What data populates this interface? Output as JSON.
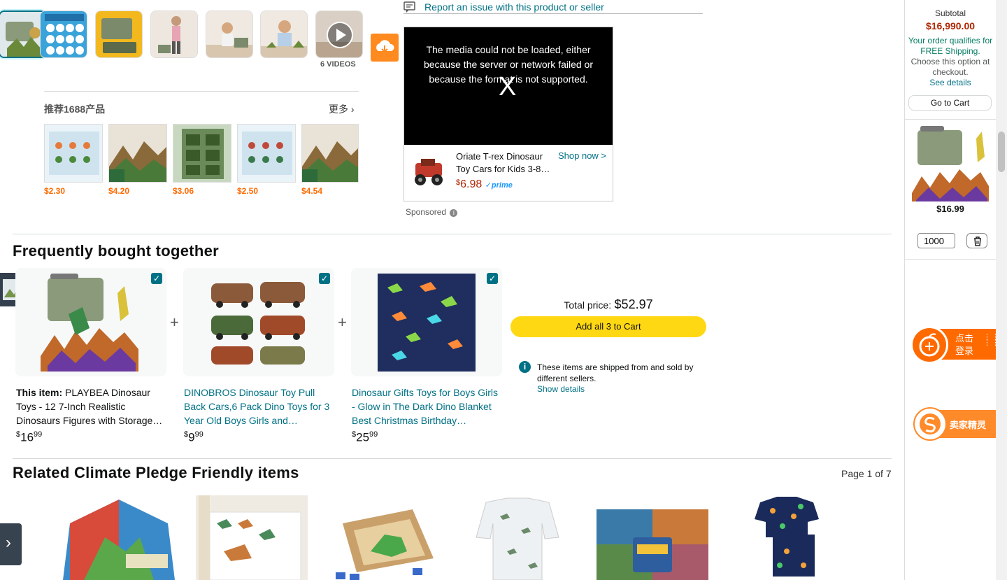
{
  "thumbnails": {
    "videos_label": "6 VIDEOS"
  },
  "report": {
    "label": "Report an issue with this product or seller"
  },
  "recommend": {
    "title": "推荐1688产品",
    "more": "更多",
    "prices": [
      "$2.30",
      "$4.20",
      "$3.06",
      "$2.50",
      "$4.54"
    ]
  },
  "ad": {
    "error_text": "The media could not be loaded, either because the server or network failed or because the format is not supported.",
    "close_x": "X",
    "product_title": "Oriate T-rex Dinosaur Toy Cars for Kids 3-8…",
    "shop_now": "Shop now >",
    "price_symbol": "$",
    "price": "6.98",
    "prime": "✓prime",
    "sponsored": "Sponsored"
  },
  "fbt": {
    "heading": "Frequently bought together",
    "items": [
      {
        "prefix": "This item: ",
        "title": "PLAYBEA Dinosaur Toys - 12 7-Inch Realistic Dinosaurs Figures with Storage…",
        "dollars": "16",
        "cents": "99"
      },
      {
        "title": "DINOBROS Dinosaur Toy Pull Back Cars,6 Pack Dino Toys for 3 Year Old Boys Girls and…",
        "dollars": "9",
        "cents": "99"
      },
      {
        "title": "Dinosaur Gifts Toys for Boys Girls - Glow in The Dark Dino Blanket Best Christmas Birthday…",
        "dollars": "25",
        "cents": "99"
      }
    ],
    "currency": "$",
    "total_label": "Total price:",
    "total_value": "$52.97",
    "add_button": "Add all 3 to Cart",
    "info_text": "These items are shipped from and sold by different sellers.",
    "show_details": "Show details"
  },
  "related": {
    "heading": "Related Climate Pledge Friendly items",
    "page": "Page 1 of 7"
  },
  "cart": {
    "subtotal_label": "Subtotal",
    "subtotal_value": "$16,990.00",
    "free_shipping_1": "Your order qualifies for FREE Shipping.",
    "free_shipping_2": "Choose this option at checkout.",
    "see_details": "See details",
    "go_to_cart": "Go to Cart",
    "item_price": "$16.99",
    "qty": "1000"
  },
  "plugin": {
    "login_text_1": "点击",
    "login_text_2": "登录",
    "seller_label": "卖家精灵"
  },
  "colors": {
    "accent": "#007185",
    "price_red": "#b12704",
    "button_yellow": "#ffd814",
    "plugin_orange": "#ff6a00"
  }
}
